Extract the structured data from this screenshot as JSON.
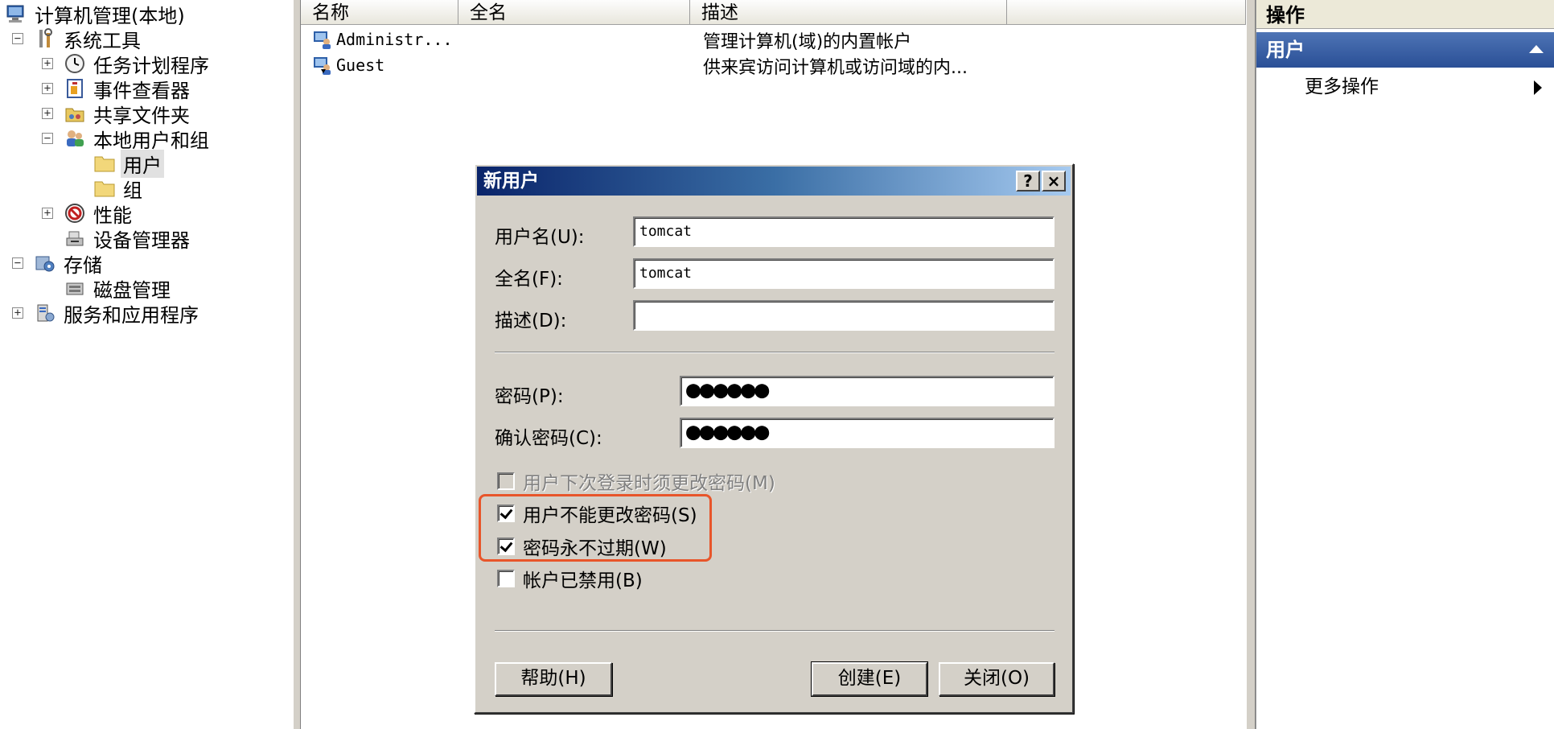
{
  "tree": {
    "items": [
      {
        "label": "计算机管理(本地)",
        "icon": "computer-management-icon",
        "expander": ""
      },
      {
        "label": "系统工具",
        "icon": "tools-icon",
        "expander": "−"
      },
      {
        "label": "任务计划程序",
        "icon": "clock-icon",
        "expander": "+"
      },
      {
        "label": "事件查看器",
        "icon": "event-viewer-icon",
        "expander": "+"
      },
      {
        "label": "共享文件夹",
        "icon": "shared-folder-icon",
        "expander": "+"
      },
      {
        "label": "本地用户和组",
        "icon": "users-group-icon",
        "expander": "−"
      },
      {
        "label": "用户",
        "icon": "folder-icon",
        "expander": ""
      },
      {
        "label": "组",
        "icon": "folder-icon",
        "expander": ""
      },
      {
        "label": "性能",
        "icon": "performance-icon",
        "expander": "+"
      },
      {
        "label": "设备管理器",
        "icon": "device-manager-icon",
        "expander": ""
      },
      {
        "label": "存储",
        "icon": "storage-icon",
        "expander": "−"
      },
      {
        "label": "磁盘管理",
        "icon": "disk-icon",
        "expander": ""
      },
      {
        "label": "服务和应用程序",
        "icon": "services-icon",
        "expander": "+"
      }
    ]
  },
  "list": {
    "columns": [
      "名称",
      "全名",
      "描述"
    ],
    "rows": [
      {
        "name": "Administr...",
        "fullname": "",
        "description": "管理计算机(域)的内置帐户",
        "icon": "user-icon"
      },
      {
        "name": "Guest",
        "fullname": "",
        "description": "供来宾访问计算机或访问域的内...",
        "icon": "guest-user-icon"
      }
    ]
  },
  "actions": {
    "title": "操作",
    "section": "用户",
    "more": "更多操作"
  },
  "dialog": {
    "title": "新用户",
    "help_caption": "?",
    "close_caption": "×",
    "username_label": "用户名(U):",
    "username_value": "tomcat",
    "fullname_label": "全名(F):",
    "fullname_value": "tomcat",
    "description_label": "描述(D):",
    "description_value": "",
    "password_label": "密码(P):",
    "password_value": "●●●●●●",
    "confirm_label": "确认密码(C):",
    "confirm_value": "●●●●●●",
    "checkboxes": [
      {
        "label": "用户下次登录时须更改密码(M)",
        "checked": false,
        "disabled": true
      },
      {
        "label": "用户不能更改密码(S)",
        "checked": true,
        "disabled": false
      },
      {
        "label": "密码永不过期(W)",
        "checked": true,
        "disabled": false
      },
      {
        "label": "帐户已禁用(B)",
        "checked": false,
        "disabled": false
      }
    ],
    "help_button": "帮助(H)",
    "create_button": "创建(E)",
    "close_button": "关闭(O)"
  }
}
